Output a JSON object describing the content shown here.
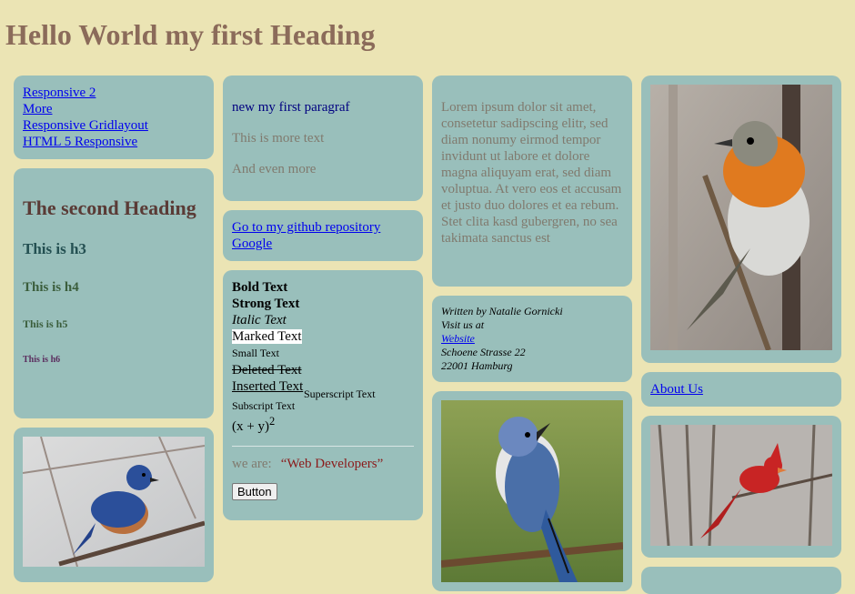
{
  "page": {
    "heading": "Hello World my first Heading"
  },
  "nav": {
    "links": [
      "Responsive 2",
      "More",
      "Responsive Gridlayout",
      "HTML 5 Responsive"
    ]
  },
  "headings": {
    "h2": "The second Heading",
    "h3": "This is h3",
    "h4": "This is h4",
    "h5": "This is h5",
    "h6": "This is h6"
  },
  "paragraphs": {
    "first": "new my first paragraf",
    "more": "This is more text",
    "even_more": "And even more"
  },
  "external_links": [
    "Go to my github repository",
    "Google"
  ],
  "formatting": {
    "bold": "Bold Text",
    "strong": "Strong Text",
    "italic": "Italic Text",
    "marked": "Marked Text",
    "small": "Small Text",
    "deleted": "Deleted Text",
    "inserted": "Inserted Text",
    "subscript": "Subscript Text",
    "superscript": "Superscript Text",
    "formula_base": "(x + y)",
    "formula_exp": "2",
    "quote_label": "we are:",
    "quote": "Web Developers",
    "button_label": "Button"
  },
  "lorem": "Lorem ipsum dolor sit amet, consetetur sadipscing elitr, sed diam nonumy eirmod tempor invidunt ut labore et dolore magna aliquyam erat, sed diam voluptua. At vero eos et accusam et justo duo dolores et ea rebum. Stet clita kasd gubergren, no sea takimata sanctus est",
  "address": {
    "written_by": "Written by Natalie Gornicki",
    "visit": "Visit us at",
    "website_link": "Website",
    "street": "Schoene Strasse 22",
    "city": "22001 Hamburg"
  },
  "about_link": "About Us",
  "colors": {
    "background": "#ebe4b4",
    "card": "#99bfbb",
    "heading": "#8b6b5a",
    "link": "#0000ee"
  },
  "images": [
    "bluebird-photo",
    "blue-jay-photo",
    "robin-photo",
    "cardinal-photo"
  ]
}
